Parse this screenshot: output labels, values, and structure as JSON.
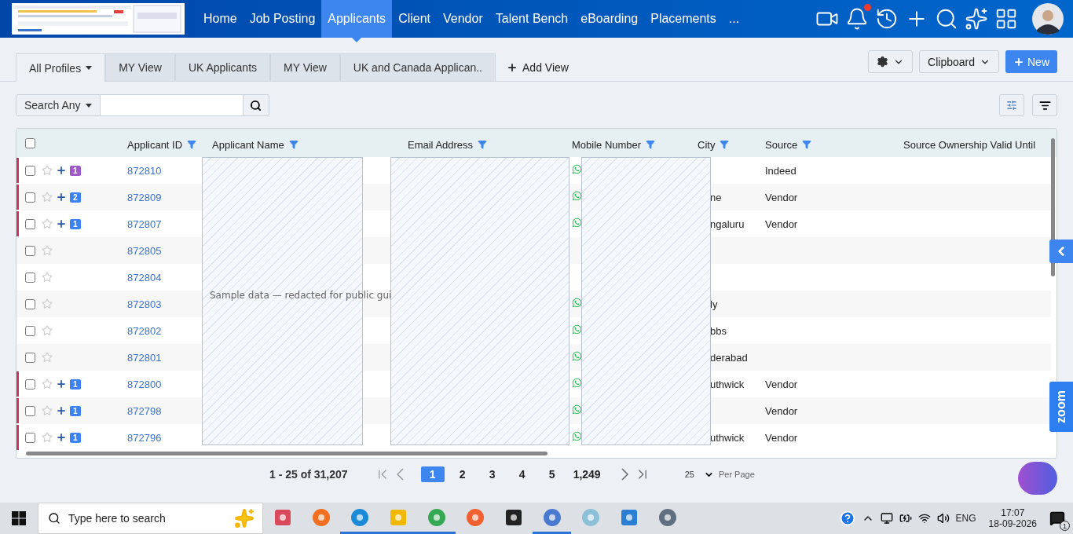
{
  "nav": {
    "items": [
      {
        "label": "Home",
        "selected": false
      },
      {
        "label": "Job Posting",
        "selected": false
      },
      {
        "label": "Applicants",
        "selected": true
      },
      {
        "label": "Client",
        "selected": false
      },
      {
        "label": "Vendor",
        "selected": false
      },
      {
        "label": "Talent Bench",
        "selected": false
      },
      {
        "label": "eBoarding",
        "selected": false
      },
      {
        "label": "Placements",
        "selected": false
      }
    ],
    "more": "...",
    "has_notification": true
  },
  "view_tabs": [
    {
      "label": "All Profiles",
      "selected": true,
      "dropdown": true
    },
    {
      "label": "MY View",
      "selected": false,
      "dropdown": false
    },
    {
      "label": "UK Applicants",
      "selected": false,
      "dropdown": false
    },
    {
      "label": "MY View",
      "selected": false,
      "dropdown": false
    },
    {
      "label": "UK and Canada Applican..",
      "selected": false,
      "dropdown": false
    }
  ],
  "add_view": "Add View",
  "toolbar": {
    "clipboard": "Clipboard",
    "new": "New"
  },
  "search": {
    "mode": "Search Any"
  },
  "table": {
    "all_checked": false,
    "columns": [
      {
        "label": "Applicant ID",
        "filter": true
      },
      {
        "label": "Applicant Name",
        "filter": true
      },
      {
        "label": "Email Address",
        "filter": true
      },
      {
        "label": "Mobile Number",
        "filter": true
      },
      {
        "label": "City",
        "filter": true
      },
      {
        "label": "Source",
        "filter": true
      },
      {
        "label": "Source Ownership Valid Until",
        "filter": false
      }
    ],
    "rows": [
      {
        "flagged": true,
        "checked": false,
        "starred": false,
        "badge": {
          "count": "1",
          "color": "#a259c8"
        },
        "id": "872810",
        "whatsapp": true,
        "city": "",
        "source": "Indeed"
      },
      {
        "flagged": true,
        "checked": false,
        "starred": false,
        "badge": {
          "count": "2",
          "color": "#3b82f6"
        },
        "id": "872809",
        "whatsapp": true,
        "city": "ne",
        "source": "Vendor"
      },
      {
        "flagged": true,
        "checked": false,
        "starred": false,
        "badge": {
          "count": "1",
          "color": "#3b82f6"
        },
        "id": "872807",
        "whatsapp": true,
        "city": "ngaluru",
        "source": "Vendor"
      },
      {
        "flagged": false,
        "checked": false,
        "starred": false,
        "id": "872805",
        "whatsapp": false,
        "city": "",
        "source": ""
      },
      {
        "flagged": false,
        "checked": false,
        "starred": false,
        "id": "872804",
        "whatsapp": false,
        "city": "",
        "source": ""
      },
      {
        "flagged": false,
        "checked": false,
        "starred": false,
        "id": "872803",
        "whatsapp": true,
        "city": "ly",
        "source": ""
      },
      {
        "flagged": false,
        "checked": false,
        "starred": false,
        "id": "872802",
        "whatsapp": true,
        "city": "bbs",
        "source": ""
      },
      {
        "flagged": false,
        "checked": false,
        "starred": false,
        "id": "872801",
        "whatsapp": true,
        "city": "derabad",
        "source": ""
      },
      {
        "flagged": true,
        "checked": false,
        "starred": false,
        "badge": {
          "count": "1",
          "color": "#3b82f6"
        },
        "id": "872800",
        "whatsapp": true,
        "city": "uthwick",
        "source": "Vendor"
      },
      {
        "flagged": true,
        "checked": false,
        "starred": false,
        "badge": {
          "count": "1",
          "color": "#3b82f6"
        },
        "id": "872798",
        "whatsapp": true,
        "city": "",
        "source": "Vendor"
      },
      {
        "flagged": true,
        "checked": false,
        "starred": false,
        "badge": {
          "count": "1",
          "color": "#3b82f6"
        },
        "id": "872796",
        "whatsapp": true,
        "city": "uthwick",
        "source": "Vendor"
      }
    ]
  },
  "redaction_note": "Sample data — redacted for public gui",
  "pagination": {
    "range": "1 - 25 of 31,207",
    "pages": [
      {
        "label": "1",
        "selected": true
      },
      {
        "label": "2",
        "selected": false
      },
      {
        "label": "3",
        "selected": false
      },
      {
        "label": "4",
        "selected": false
      },
      {
        "label": "5",
        "selected": false
      },
      {
        "label": "1,249",
        "selected": false
      }
    ],
    "per_page": "25",
    "per_page_label": "Per Page"
  },
  "side_tab": "zoom",
  "taskbar": {
    "search_placeholder": "Type here to search",
    "language": "ENG",
    "time": "17:07",
    "date": "18-09-2026",
    "notification_count": "1"
  }
}
